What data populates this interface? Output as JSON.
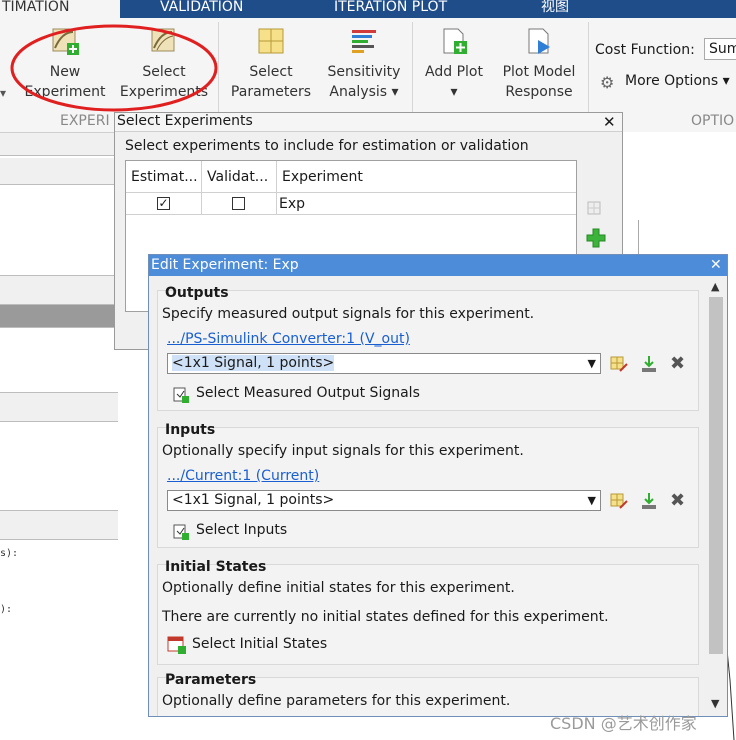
{
  "ribbon": {
    "tabs": [
      "TIMATION",
      "VALIDATION",
      "ITERATION PLOT",
      "视图"
    ],
    "buttons": {
      "new_experiment": [
        "New",
        "Experiment"
      ],
      "select_experiments": [
        "Select",
        "Experiments"
      ],
      "select_parameters": [
        "Select",
        "Parameters"
      ],
      "sensitivity_analysis": [
        "Sensitivity",
        "Analysis ▾"
      ],
      "add_plot": [
        "Add Plot",
        "▾"
      ],
      "plot_model_response": [
        "Plot Model",
        "Response"
      ]
    },
    "cost_function_label": "Cost Function:",
    "cost_function_value": "Sum",
    "more_options": "More Options ▾",
    "group_labels": {
      "experiments": "EXPERI",
      "options": "OPTIO"
    }
  },
  "left_panel": {
    "code_lines": [
      "s):",
      "):"
    ]
  },
  "select_dialog": {
    "title": "Select Experiments",
    "instruction": "Select experiments to include for estimation or validation",
    "columns": [
      "Estimat...",
      "Validat...",
      "Experiment"
    ],
    "rows": [
      {
        "estimation": true,
        "validation": false,
        "experiment": "Exp"
      }
    ]
  },
  "edit_dialog": {
    "title": "Edit Experiment: Exp",
    "outputs": {
      "heading": "Outputs",
      "description": "Specify measured output signals for this experiment.",
      "signal_link": ".../PS-Simulink Converter:1 (V_out)",
      "signal_value": "<1x1 Signal, 1 points>",
      "select_button": "Select Measured Output Signals"
    },
    "inputs": {
      "heading": "Inputs",
      "description": "Optionally specify input signals for this experiment.",
      "signal_link": ".../Current:1 (Current)",
      "signal_value": "<1x1 Signal, 1 points>",
      "select_button": "Select Inputs"
    },
    "initial_states": {
      "heading": "Initial States",
      "description": "Optionally define initial states for this experiment.",
      "note": "There are currently no initial states defined for this experiment.",
      "select_button": "Select Initial States"
    },
    "parameters": {
      "heading": "Parameters",
      "description": "Optionally define parameters for this experiment."
    }
  },
  "watermark": "CSDN @艺术创作家",
  "colors": {
    "title_active": "#4c8cd8",
    "tab_bar": "#1f4d8a",
    "link": "#1a5fd1",
    "highlight_circle": "#e02020",
    "selection": "#cfe1f7"
  }
}
